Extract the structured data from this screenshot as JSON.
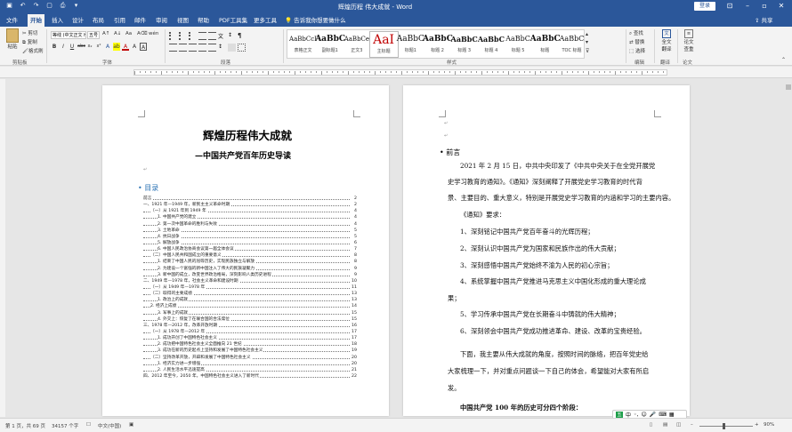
{
  "window": {
    "title": "辉煌历程 伟大成就 - Word",
    "login_label": "登录",
    "share_label": "共享",
    "tell_me": "告诉我你想要做什么"
  },
  "tabs": [
    "文件",
    "开始",
    "插入",
    "设计",
    "布局",
    "引用",
    "邮件",
    "审阅",
    "视图",
    "帮助",
    "PDF工具集",
    "更多工具"
  ],
  "ribbon": {
    "clipboard": {
      "paste": "粘贴",
      "cut": "剪切",
      "copy": "复制",
      "format_painter": "格式刷",
      "label": "剪贴板"
    },
    "font": {
      "name": "等线 (中文正文 Heu",
      "size": "五号",
      "label": "字体",
      "buttons": [
        "B",
        "I",
        "U",
        "abc",
        "x₂",
        "x²",
        "A",
        "A"
      ]
    },
    "paragraph": {
      "label": "段落"
    },
    "styles": {
      "label": "样式",
      "items": [
        {
          "sample": "AaBbCcI",
          "name": "表格正文"
        },
        {
          "sample": "AaBbC",
          "name": "副标题1"
        },
        {
          "sample": "AaBbCe",
          "name": "正文3"
        },
        {
          "sample": "AaI",
          "name": "主标题"
        },
        {
          "sample": "AaBbC",
          "name": "标题1"
        },
        {
          "sample": "AaBbC",
          "name": "标题 2"
        },
        {
          "sample": "AaBbC",
          "name": "标题 3"
        },
        {
          "sample": "AaBbC",
          "name": "标题 4"
        },
        {
          "sample": "AaBbC",
          "name": "标题 5"
        },
        {
          "sample": "AaBbC",
          "name": "标题"
        },
        {
          "sample": "AaBbC",
          "name": "TOC 标题"
        }
      ]
    },
    "editing": {
      "find": "查找",
      "replace": "替换",
      "select": "选择",
      "label": "编辑"
    },
    "translate": {
      "l1": "全文",
      "l2": "翻译",
      "label": "翻译"
    },
    "review": {
      "l1": "论文",
      "l2": "查重",
      "label": "论文"
    }
  },
  "page1": {
    "title": "辉煌历程伟大成就",
    "subtitle": "—中国共产党百年历史导读",
    "toc_heading": "目录",
    "toc": [
      {
        "text": "前言",
        "page": "2",
        "indent": 0
      },
      {
        "text": "一、1921 年—1949 年，新民主主义革命时期",
        "page": "2",
        "indent": 0
      },
      {
        "text": "（一）从 1921 年到 1949 年",
        "page": "4",
        "indent": 1
      },
      {
        "text": "1. 中国共产党的建立",
        "page": "4",
        "indent": 2
      },
      {
        "text": "2. 第一次中国革命的胜利与失败",
        "page": "4",
        "indent": 2
      },
      {
        "text": "3. 土地革命",
        "page": "5",
        "indent": 2
      },
      {
        "text": "4. 抗日战争",
        "page": "5",
        "indent": 2
      },
      {
        "text": "5. 解放战争",
        "page": "6",
        "indent": 2
      },
      {
        "text": "6. 中国人民政治协商会议第一届全体会议",
        "page": "7",
        "indent": 2
      },
      {
        "text": "（二）中国人民共和国成立的重要意义",
        "page": "8",
        "indent": 1
      },
      {
        "text": "1. 结束了中国人民的屈辱历史，实现民族独立与解放",
        "page": "8",
        "indent": 2
      },
      {
        "text": "2. 为建设一个富强的新中国注入了伟大的民族凝聚力",
        "page": "9",
        "indent": 2
      },
      {
        "text": "3. 新中国的成立，改变世界政治格局，深刻影响人类历史进程",
        "page": "9",
        "indent": 2
      },
      {
        "text": "二、1949 年—1978 年，社会主义革命和建设时期",
        "page": "10",
        "indent": 0
      },
      {
        "text": "（一）从 1949 年—1978 年",
        "page": "11",
        "indent": 1
      },
      {
        "text": "（二）取得的主要成绩",
        "page": "13",
        "indent": 1
      },
      {
        "text": "1. 政治上的成就",
        "page": "13",
        "indent": 2
      },
      {
        "text": "2. 经济上成绩",
        "page": "14",
        "indent": 1
      },
      {
        "text": "3. 军事上的成就",
        "page": "15",
        "indent": 2
      },
      {
        "text": "4. 外交上：恢复了在联合国的合法席位",
        "page": "15",
        "indent": 2
      },
      {
        "text": "三、1978 年—2012 年，改革开放时期",
        "page": "16",
        "indent": 0
      },
      {
        "text": "（一）从 1978 年—2012 年",
        "page": "17",
        "indent": 1
      },
      {
        "text": "1. 成功开创了中国特色社会主义",
        "page": "17",
        "indent": 2
      },
      {
        "text": "2. 成功把中国特色社会主义全面推向 21 世纪",
        "page": "18",
        "indent": 2
      },
      {
        "text": "3. 成功在新的历史起点上坚持和发展了中国特色社会主义",
        "page": "19",
        "indent": 2
      },
      {
        "text": "（二）坚持改革开放，开辟和发展了中国特色社会主义",
        "page": "20",
        "indent": 1
      },
      {
        "text": "1. 经济实力进一步增强",
        "page": "20",
        "indent": 2
      },
      {
        "text": "2. 人民生活水平迅速提高",
        "page": "21",
        "indent": 2
      },
      {
        "text": "四、2012 年至今，2050 年，中国特色社会主义进入了新时代",
        "page": "22",
        "indent": 0
      }
    ]
  },
  "page2": {
    "preface": "前言",
    "lines": [
      "2021 年 2 月 15 日，中共中央印发了《中共中央关于在全党开展党",
      "史学习教育的通知》。《通知》深刻阐释了开展党史学习教育的时代背",
      "景、主要目的、重大意义，特别是开展党史学习教育的内涵和学习的主要内容。",
      "《通知》要求：",
      "1、深刻铭记中国共产党百年奋斗的光辉历程；",
      "2、深刻认识中国共产党为国家和民族作出的伟大贡献；",
      "3、深刻感悟中国共产党始终不渝为人民的初心宗旨；",
      "4、系统掌握中国共产党推进马克思主义中国化形成的重大理论成",
      "果；",
      "5、学习传承中国共产党在长期奋斗中铸就的伟大精神；",
      "6、深刻领会中国共产党成功推进革命、建设、改革的宝贵经验。",
      "下面，我主要从伟大成就的角度，按照时间的脉络，把百年党史给",
      "大家梳理一下，并对重点问题谈一下自己的体会，希望能对大家有所启",
      "发。",
      "中国共产党 100 年的历史可分四个阶段："
    ]
  },
  "statusbar": {
    "page": "第 1 页，共 69 页",
    "words": "34157 个字",
    "lang": "中文(中国)",
    "zoom": "90%"
  },
  "ime": {
    "label": "五"
  }
}
